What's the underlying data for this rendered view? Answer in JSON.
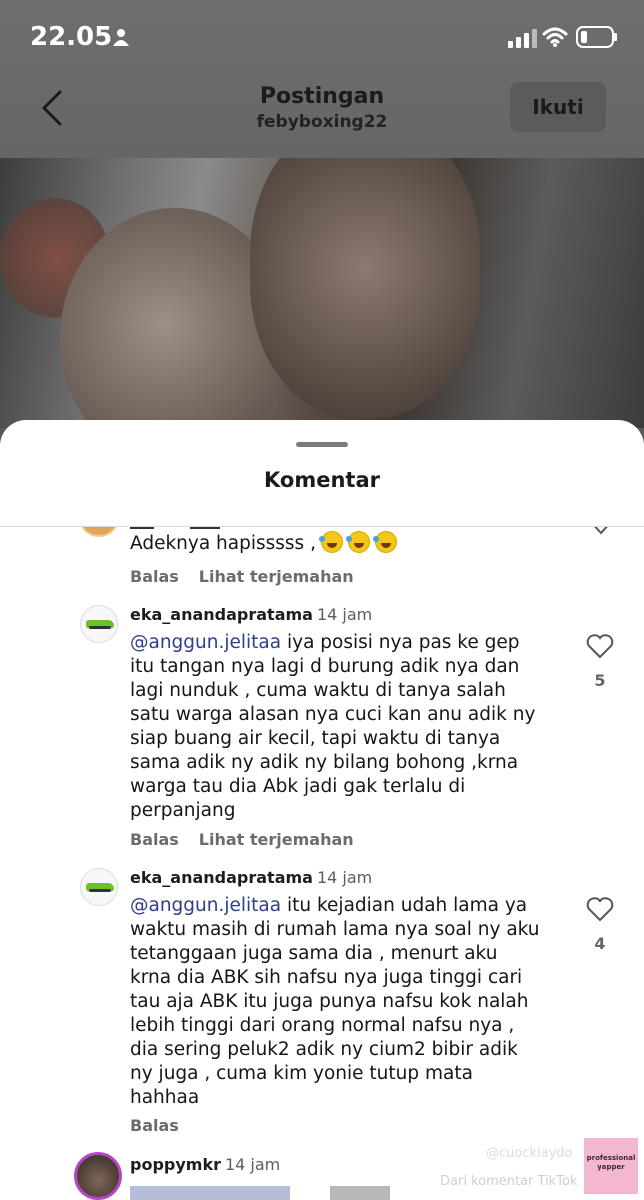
{
  "status_bar": {
    "time": "22.05"
  },
  "header": {
    "title": "Postingan",
    "subtitle": "febyboxing22",
    "follow_label": "Ikuti"
  },
  "sheet": {
    "title": "Komentar"
  },
  "comments": [
    {
      "text": "Adeknya hapisssss ,",
      "emoji": "rolling-on-floor-laughing",
      "reply_label": "Balas",
      "translate_label": "Lihat terjemahan"
    },
    {
      "username": "eka_anandapratama",
      "time": "14 jam",
      "mention": "@anggun.jelitaa",
      "text_lines": [
        "iya posisi nya pas ke gep",
        "itu tangan nya lagi d burung adik nya dan",
        "lagi nunduk , cuma waktu di tanya salah",
        "satu warga alasan nya cuci kan anu adik ny",
        "siap buang air kecil, tapi waktu di tanya",
        "sama adik ny adik ny bilang bohong ,krna",
        "warga tau dia Abk jadi gak terlalu di",
        "perpanjang"
      ],
      "likes": "5",
      "reply_label": "Balas",
      "translate_label": "Lihat terjemahan"
    },
    {
      "username": "eka_anandapratama",
      "time": "14 jam",
      "mention": "@anggun.jelitaa",
      "text_lines": [
        "itu kejadian udah lama ya",
        "waktu masih di rumah lama nya soal ny aku",
        "tetanggaan juga sama dia , menurt aku",
        "krna dia ABK sih nafsu nya juga tinggi cari",
        "tau aja ABK itu juga punya nafsu kok nalah",
        "lebih tinggi dari orang normal nafsu nya ,",
        "dia sering peluk2 adik ny cium2 bibir adik",
        "ny juga , cuma kim yonie tutup mata",
        "hahhaa"
      ],
      "likes": "4",
      "reply_label": "Balas"
    },
    {
      "username": "poppymkr",
      "time": "14 jam"
    }
  ],
  "watermarks": {
    "handle": "@cuocklaydo",
    "caption": "Dari komentar TikTok",
    "badge": "professional yapper"
  },
  "colors": {
    "mention": "#2d3e8e",
    "sheet_bg": "#ffffff",
    "overlay": "#6a6a6a"
  }
}
